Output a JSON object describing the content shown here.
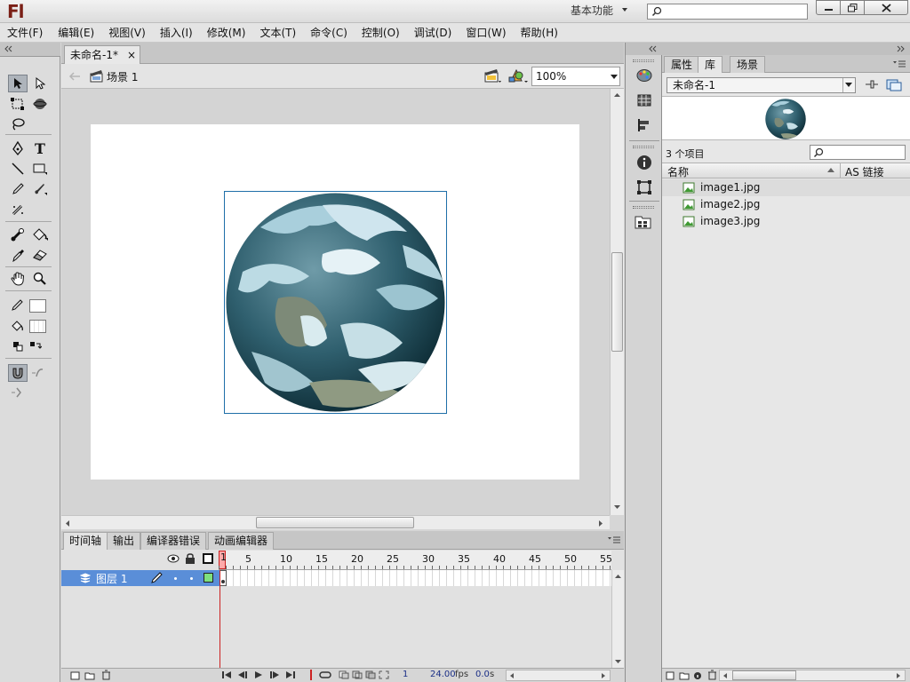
{
  "app": {
    "logo": "Fl",
    "workspace_label": "基本功能",
    "window_controls": [
      "minimize-icon",
      "restore-icon",
      "close-icon"
    ]
  },
  "menubar": {
    "items": [
      "文件(F)",
      "编辑(E)",
      "视图(V)",
      "插入(I)",
      "修改(M)",
      "文本(T)",
      "命令(C)",
      "控制(O)",
      "调试(D)",
      "窗口(W)",
      "帮助(H)"
    ]
  },
  "document": {
    "tab_title": "未命名-1*",
    "tab_close": "×",
    "scene_label": "场景 1",
    "zoom_value": "100%"
  },
  "stage": {
    "background_color": "#ffffff",
    "pasteboard_color": "#d4d4d4",
    "selection_color": "#1f6fa8",
    "symbol": "earth-image"
  },
  "timeline": {
    "tabs": [
      "时间轴",
      "输出",
      "编译器错误",
      "动画编辑器"
    ],
    "frame_numbers": [
      "1",
      "5",
      "10",
      "15",
      "20",
      "25",
      "30",
      "35",
      "40",
      "45",
      "50",
      "55"
    ],
    "layer_name": "图层 1",
    "status": {
      "current_frame": "1",
      "frame_rate": "24.00",
      "fps_unit": "fps",
      "elapsed": "0.0",
      "elapsed_unit": "s"
    }
  },
  "library": {
    "tabs": [
      "属性",
      "库",
      "场景"
    ],
    "active_tab": "库",
    "document_select": "未命名-1",
    "item_count": "3 个项目",
    "columns": {
      "name": "名称",
      "linkage": "AS 链接"
    },
    "items": [
      "image1.jpg",
      "image2.jpg",
      "image3.jpg"
    ]
  },
  "colors": {
    "layer_highlight": "#5a8ed8",
    "playhead": "#cc2222",
    "keyframe_fill": "#7ee07e"
  }
}
